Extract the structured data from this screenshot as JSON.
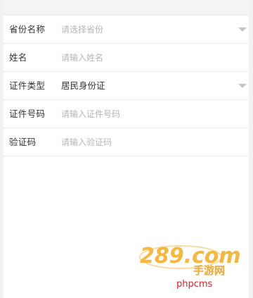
{
  "form": {
    "province": {
      "label": "省份名称",
      "placeholder": "请选择省份"
    },
    "name": {
      "label": "姓名",
      "placeholder": "请输入姓名"
    },
    "id_type": {
      "label": "证件类型",
      "value": "居民身份证"
    },
    "id_number": {
      "label": "证件号码",
      "placeholder": "请输入证件号码"
    },
    "captcha": {
      "label": "验证码",
      "placeholder": "请输入验证码"
    }
  },
  "watermark": {
    "logo_text": "289.com",
    "logo_subtext": "手游网",
    "site_text": "phpcms"
  }
}
